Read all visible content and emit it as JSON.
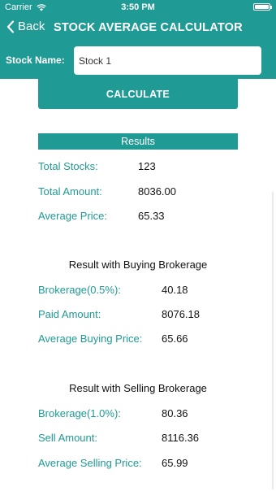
{
  "status": {
    "carrier": "Carrier",
    "time": "3:50 PM",
    "battery_level": 1.0
  },
  "nav": {
    "back_label": "Back",
    "title": "STOCK AVERAGE CALCULATOR"
  },
  "stock": {
    "label": "Stock Name:",
    "value": "Stock 1"
  },
  "calculate_label": "CALCULATE",
  "results": {
    "header": "Results",
    "total_stocks_label": "Total Stocks:",
    "total_stocks_value": "123",
    "total_amount_label": "Total Amount:",
    "total_amount_value": "8036.00",
    "average_price_label": "Average Price:",
    "average_price_value": "65.33"
  },
  "buying": {
    "title": "Result with Buying Brokerage",
    "brokerage_label": "Brokerage(0.5%):",
    "brokerage_value": "40.18",
    "paid_label": "Paid Amount:",
    "paid_value": "8076.18",
    "avg_label": "Average Buying Price:",
    "avg_value": "65.66"
  },
  "selling": {
    "title": "Result with Selling Brokerage",
    "brokerage_label": "Brokerage(1.0%):",
    "brokerage_value": "80.36",
    "sell_label": "Sell Amount:",
    "sell_value": "8116.36",
    "avg_label": "Average Selling Price:",
    "avg_value": "65.99"
  },
  "colors": {
    "accent": "#1f9a95",
    "text": "#111111",
    "background": "#ffffff"
  }
}
